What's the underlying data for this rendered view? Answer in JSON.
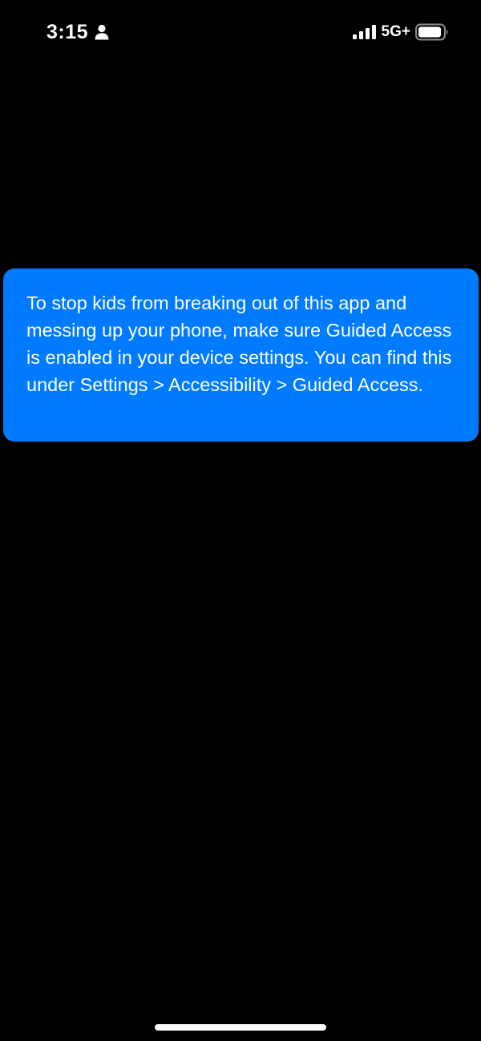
{
  "status_bar": {
    "time": "3:15",
    "network": "5G+",
    "icons": {
      "person": "person-icon",
      "signal": "cellular-signal-icon",
      "battery": "battery-icon"
    }
  },
  "banner": {
    "message": "To stop kids from breaking out of this app and messing up your phone, make sure Guided Access is enabled in your device settings. You can find this under Settings > Accessibility > Guided Access.",
    "background_color": "#007AFF",
    "text_color": "#FFFFFF"
  },
  "theme": {
    "background": "#000000"
  }
}
